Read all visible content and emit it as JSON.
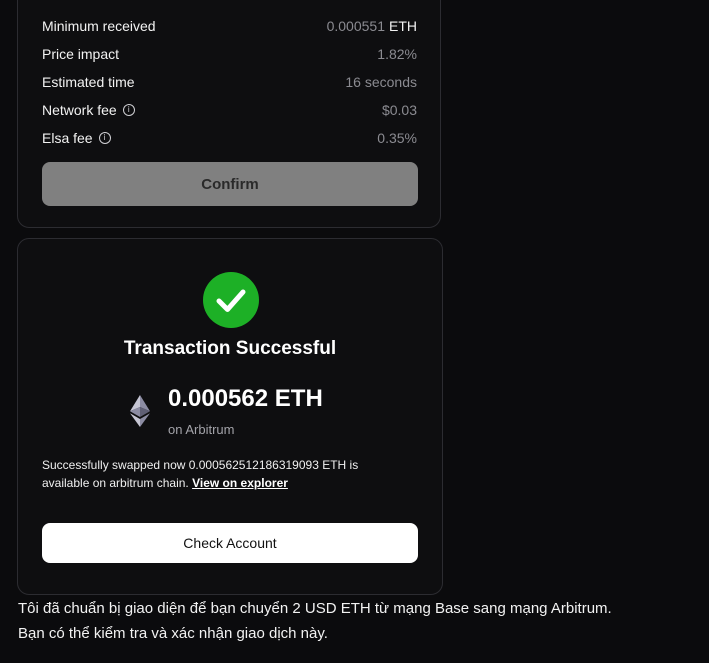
{
  "details": {
    "rows": [
      {
        "label": "Minimum received",
        "value": "0.000551",
        "unit": "ETH"
      },
      {
        "label": "Price impact",
        "value": "1.82%"
      },
      {
        "label": "Estimated time",
        "value": "16 seconds"
      },
      {
        "label": "Network fee",
        "value": "$0.03",
        "info_icon": "info-icon"
      },
      {
        "label": "Elsa fee",
        "value": "0.35%",
        "info_icon": "info-icon"
      }
    ],
    "confirm_label": "Confirm"
  },
  "success": {
    "icon": "check-circle-icon",
    "title": "Transaction Successful",
    "token_icon": "ethereum-icon",
    "amount": "0.000562 ETH",
    "network": "on Arbitrum",
    "description": "Successfully swapped now 0.000562512186319093 ETH is available on arbitrum chain.",
    "explorer_link": "View on explorer",
    "check_account_label": "Check Account"
  },
  "message": {
    "line1": "Tôi đã chuẩn bị giao diện để bạn chuyển 2 USD ETH từ mạng Base sang mạng Arbitrum.",
    "line2": "Bạn có thể kiểm tra và xác nhận giao dịch này."
  },
  "colors": {
    "background": "#0b0b0d",
    "success_green": "#1db026",
    "confirm_disabled": "#808080",
    "card_border": "#2c2c31"
  }
}
